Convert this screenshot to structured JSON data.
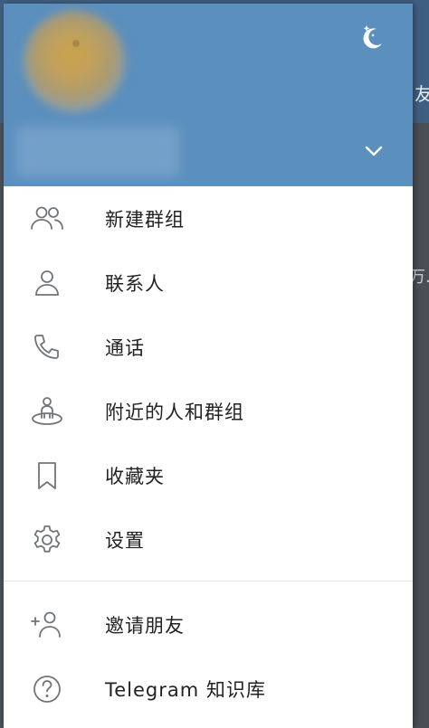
{
  "background": {
    "header_fragment": "友",
    "body_fragment": "万."
  },
  "drawer": {
    "theme_icon": "moon-stars-icon",
    "expand_icon": "chevron-down-icon",
    "colors": {
      "header": "#5b8fbe",
      "icon": "#707579",
      "text": "#222222"
    },
    "menu": [
      {
        "label": "新建群组",
        "icon": "new-group-icon"
      },
      {
        "label": "联系人",
        "icon": "contact-icon"
      },
      {
        "label": "通话",
        "icon": "phone-icon"
      },
      {
        "label": "附近的人和群组",
        "icon": "people-nearby-icon"
      },
      {
        "label": "收藏夹",
        "icon": "bookmark-icon"
      },
      {
        "label": "设置",
        "icon": "settings-icon"
      }
    ],
    "secondary_menu": [
      {
        "label": "邀请朋友",
        "icon": "invite-friend-icon"
      },
      {
        "label": "Telegram 知识库",
        "icon": "help-icon"
      }
    ]
  }
}
